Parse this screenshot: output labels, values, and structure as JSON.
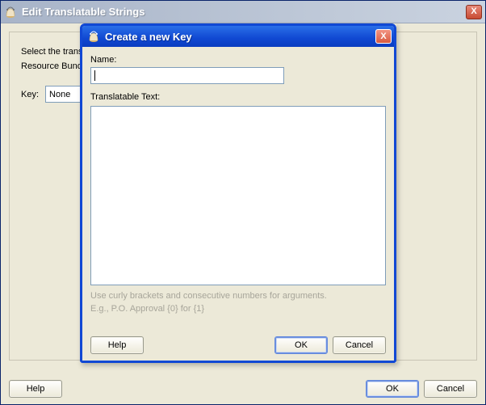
{
  "outer": {
    "title": "Edit Translatable Strings",
    "close_label": "X",
    "instr1": "Select the transl",
    "instr2": "Resource Bundle",
    "key_label": "Key:",
    "key_value": "None",
    "help_label": "Help",
    "ok_label": "OK",
    "cancel_label": "Cancel"
  },
  "modal": {
    "title": "Create a new Key",
    "close_label": "X",
    "name_label": "Name:",
    "name_value": "",
    "text_label": "Translatable Text:",
    "text_value": "",
    "hint_line1": "Use curly brackets and consecutive numbers for arguments.",
    "hint_line2": "E.g., P.O. Approval {0} for {1}",
    "help_label": "Help",
    "ok_label": "OK",
    "cancel_label": "Cancel"
  }
}
